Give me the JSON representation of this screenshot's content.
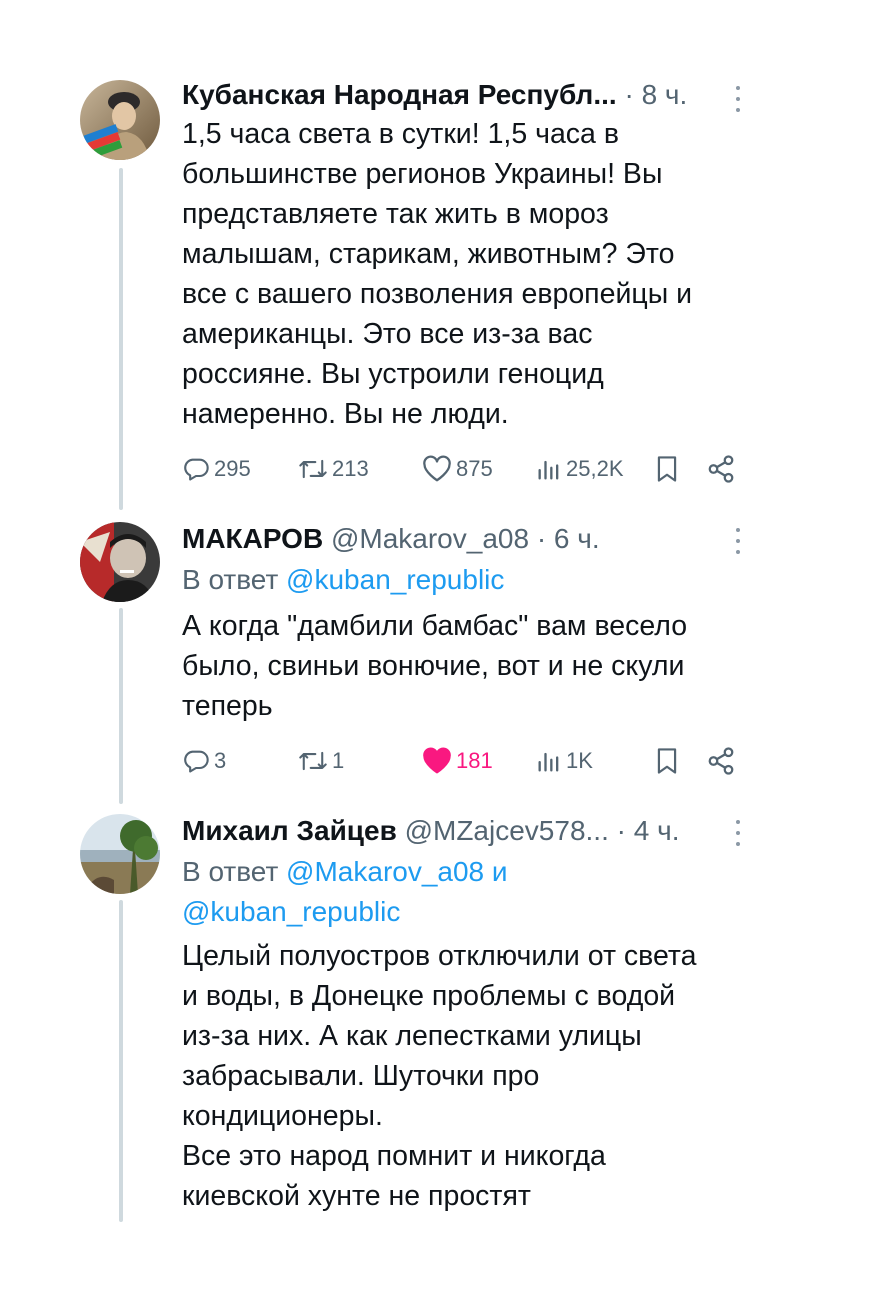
{
  "tweets": [
    {
      "name": "Кубанская Народная Республ...",
      "handle": "",
      "sep": "·",
      "time": "8 ч.",
      "reply_prefix": "",
      "reply_mentions": [],
      "text": "1,5 часа света в сутки! 1,5 часа в\nбольшинстве регионов Украины!  Вы\nпредставляете так жить в мороз\nмалышам, старикам, животным? Это\nвсе с вашего позволения европейцы и\nамериканцы. Это все из-за вас\nроссияне. Вы устроили геноцид\nнамеренно. Вы не люди.",
      "stats": {
        "replies": "295",
        "reposts": "213",
        "likes": "875",
        "views": "25,2K",
        "liked": false
      }
    },
    {
      "name": "МАКАРОВ",
      "handle": "@Makarov_a08",
      "sep": "·",
      "time": "6 ч.",
      "reply_prefix": "В ответ",
      "reply_mention_1": "@kuban_republic",
      "text": "А когда \"дамбили бамбас\" вам весело\nбыло, свиньи вонючие, вот и не скули\nтеперь",
      "stats": {
        "replies": "3",
        "reposts": "1",
        "likes": "181",
        "views": "1K",
        "liked": true
      }
    },
    {
      "name": "Михаил Зайцев",
      "handle": "@MZajcev578...",
      "sep": "·",
      "time": "4 ч.",
      "reply_prefix": "В ответ",
      "reply_mention_1": "@Makarov_a08",
      "reply_and": "и",
      "reply_mention_2": "@kuban_republic",
      "text": "Целый полуостров отключили от света\nи воды, в Донецке проблемы с водой\nиз-за них. А как лепестками улицы\nзабрасывали. Шуточки про\nкондиционеры.\nВсе это народ помнит и никогда\nкиевской хунте не простят"
    }
  ],
  "icons": {
    "reply": "comment-icon",
    "repost": "repost-icon",
    "like": "heart-icon",
    "views": "views-icon",
    "bookmark": "bookmark-icon",
    "share": "share-icon",
    "more": "more-icon"
  },
  "colors": {
    "text": "#0f1419",
    "secondary": "#536471",
    "mention": "#1d9bf0",
    "like": "#f91880",
    "thread": "#cfd9de"
  }
}
